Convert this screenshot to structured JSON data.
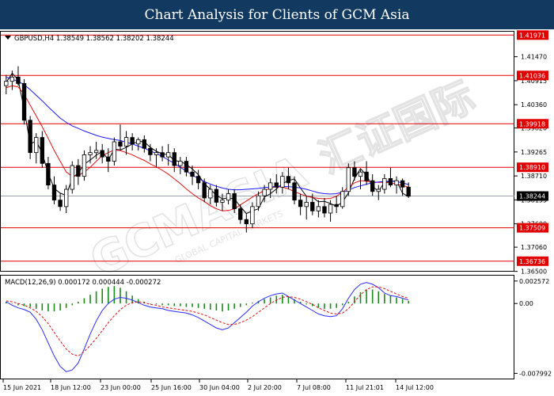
{
  "banner": {
    "title": "Chart Analysis for Clients of GCM Asia"
  },
  "colors": {
    "banner_bg": "#12395f",
    "level_line": "#e00000",
    "ma_fast": "#000000",
    "ma_mid": "#e01010",
    "ma_slow": "#1a1aff",
    "macd_line": "#2a2aff",
    "signal_line": "#e01010",
    "histogram": "#1a8a1a",
    "candle": "#000000"
  },
  "watermark": {
    "brand": "GCMASIA",
    "chinese": "汇证国际",
    "tagline": "GLOBAL CAPITAL MARKETS"
  },
  "main_chart": {
    "symbol_info": "GBPUSD,H4  1.38549 1.38562 1.38202 1.38244",
    "ylim": [
      1.3653,
      1.4205
    ],
    "y_ticks": [
      "1.41470",
      "1.40915",
      "1.40360",
      "1.39820",
      "1.39265",
      "1.38710",
      "1.38155",
      "1.37600",
      "1.37060",
      "1.36500"
    ],
    "levels": [
      {
        "value": 1.41971,
        "label": "1.41971"
      },
      {
        "value": 1.41036,
        "label": "1.41036"
      },
      {
        "value": 1.39918,
        "label": "1.39918"
      },
      {
        "value": 1.3891,
        "label": "1.38910"
      },
      {
        "value": 1.37509,
        "label": "1.37509"
      },
      {
        "value": 1.36736,
        "label": "1.36736"
      }
    ],
    "current_price": {
      "value": 1.38244,
      "label": "1.38244"
    }
  },
  "macd_panel": {
    "label": "MACD(12,26,9) 0.000172 0.000444 -0.000272",
    "ylim": [
      -0.0085,
      0.0031
    ],
    "y_ticks": [
      {
        "value": 0.002572,
        "label": "0.002572"
      },
      {
        "value": 0.0,
        "label": "0.00"
      },
      {
        "value": -0.007992,
        "label": "-0.007992"
      }
    ]
  },
  "x_axis": {
    "labels": [
      "15 Jun 2021",
      "18 Jun 12:00",
      "23 Jun 00:00",
      "25 Jun 16:00",
      "30 Jun 04:00",
      "2 Jul 20:00",
      "7 Jul 08:00",
      "11 Jul 21:01",
      "14 Jul 12:00"
    ]
  },
  "chart_data": {
    "type": "line",
    "series": [
      {
        "values": [
          1.4087,
          1.4109,
          1.4093,
          1.4025,
          1.3945,
          1.3952,
          1.3924,
          1.3877,
          1.3842,
          1.3831,
          1.3826,
          1.3866,
          1.3878,
          1.3898,
          1.3908,
          1.3919,
          1.3928,
          1.3908,
          1.3933,
          1.3931,
          1.3937,
          1.3945,
          1.3951,
          1.395,
          1.3937,
          1.3928,
          1.3922,
          1.392,
          1.3907,
          1.3904,
          1.3898,
          1.3887,
          1.3874,
          1.3853,
          1.384,
          1.3826,
          1.3818,
          1.382,
          1.3818,
          1.38,
          1.3784,
          1.379,
          1.3795,
          1.3822,
          1.383,
          1.3841,
          1.3853,
          1.386,
          1.3864,
          1.3843,
          1.3824,
          1.3822,
          1.3811,
          1.3812,
          1.3807,
          1.3801,
          1.381,
          1.3832,
          1.3865,
          1.3888,
          1.3872,
          1.3847,
          1.3835,
          1.3857,
          1.3858,
          1.386,
          1.3831,
          1.3823
        ]
      },
      {
        "values": [
          1.4075,
          1.408,
          1.4077,
          1.406,
          1.4035,
          1.401,
          1.3985,
          1.3958,
          1.393,
          1.3905,
          1.388,
          1.387,
          1.3872,
          1.388,
          1.3891,
          1.3905,
          1.3918,
          1.3925,
          1.3931,
          1.393,
          1.3925,
          1.392,
          1.3913,
          1.3907,
          1.3899,
          1.3892,
          1.3884,
          1.3875,
          1.3864,
          1.3853,
          1.3841,
          1.383,
          1.382,
          1.3812,
          1.3802,
          1.3795,
          1.379,
          1.3791,
          1.3795,
          1.3804,
          1.3813,
          1.3822,
          1.383,
          1.3837,
          1.3843,
          1.3846,
          1.3845,
          1.3841,
          1.3835,
          1.3829,
          1.3824,
          1.3821,
          1.3819,
          1.3818,
          1.3819,
          1.3824,
          1.3833,
          1.3845,
          1.3855,
          1.386,
          1.3859,
          1.3857,
          1.3856,
          1.3856,
          1.3855,
          1.3852,
          1.3849,
          1.3845
        ]
      },
      {
        "values": [
          1.41,
          1.4095,
          1.409,
          1.4082,
          1.4071,
          1.4058,
          1.4045,
          1.4031,
          1.4018,
          1.4005,
          1.3995,
          1.3987,
          1.3981,
          1.3975,
          1.397,
          1.3965,
          1.3961,
          1.3958,
          1.3955,
          1.3953,
          1.3949,
          1.3945,
          1.394,
          1.3935,
          1.3929,
          1.3923,
          1.3916,
          1.3908,
          1.39,
          1.3891,
          1.3882,
          1.3873,
          1.3865,
          1.3858,
          1.3852,
          1.3847,
          1.3843,
          1.384,
          1.3839,
          1.3839,
          1.384,
          1.3841,
          1.3842,
          1.3844,
          1.3845,
          1.3847,
          1.3847,
          1.3846,
          1.3845,
          1.3843,
          1.384,
          1.3836,
          1.3832,
          1.383,
          1.3829,
          1.383,
          1.3833,
          1.3838,
          1.3844,
          1.3848,
          1.3852,
          1.3855,
          1.3857,
          1.3858,
          1.3859,
          1.3858,
          1.3855,
          1.3851
        ]
      },
      {
        "values": [
          0.0002,
          -0.0002,
          -0.0005,
          -0.0007,
          -0.001,
          -0.0018,
          -0.003,
          -0.0045,
          -0.006,
          -0.0072,
          -0.0078,
          -0.0076,
          -0.0068,
          -0.0052,
          -0.0035,
          -0.002,
          -0.0008,
          0.0,
          0.0005,
          0.0007,
          0.0006,
          0.0004,
          0.0001,
          -0.0002,
          -0.0004,
          -0.0005,
          -0.0006,
          -0.0008,
          -0.0009,
          -0.001,
          -0.0011,
          -0.0013,
          -0.0016,
          -0.002,
          -0.0024,
          -0.0028,
          -0.003,
          -0.0028,
          -0.0022,
          -0.0016,
          -0.001,
          -0.0003,
          0.0002,
          0.0006,
          0.0009,
          0.0011,
          0.0012,
          0.0008,
          0.0004,
          0.0,
          -0.0004,
          -0.0008,
          -0.0012,
          -0.0014,
          -0.0015,
          -0.0014,
          -0.0006,
          0.0006,
          0.0016,
          0.0022,
          0.0024,
          0.0022,
          0.0018,
          0.0012,
          0.0009,
          0.0008,
          0.0006,
          0.0004
        ]
      },
      {
        "values": [
          0.0003,
          0.0002,
          0.0,
          -0.0002,
          -0.0005,
          -0.0009,
          -0.0015,
          -0.0023,
          -0.0033,
          -0.0043,
          -0.0052,
          -0.0058,
          -0.006,
          -0.0055,
          -0.0048,
          -0.004,
          -0.0031,
          -0.0022,
          -0.0014,
          -0.0007,
          -0.0002,
          0.0001,
          0.0002,
          0.0001,
          -0.0001,
          -0.0002,
          -0.0004,
          -0.0005,
          -0.0006,
          -0.0007,
          -0.0008,
          -0.0009,
          -0.0011,
          -0.0013,
          -0.0016,
          -0.0019,
          -0.0022,
          -0.0024,
          -0.0024,
          -0.0022,
          -0.0019,
          -0.0015,
          -0.001,
          -0.0005,
          0.0,
          0.0004,
          0.0007,
          0.0008,
          0.0007,
          0.0005,
          0.0002,
          -0.0001,
          -0.0005,
          -0.0008,
          -0.0011,
          -0.0012,
          -0.0011,
          -0.0006,
          0.0002,
          0.001,
          0.0016,
          0.0019,
          0.0019,
          0.0017,
          0.0014,
          0.0011,
          0.0008,
          0.0006
        ]
      },
      {
        "values": [
          -0.0001,
          -0.0004,
          -0.0005,
          -0.0005,
          -0.0005,
          -0.0009,
          -0.0015,
          -0.0022,
          -0.0027,
          -0.0029,
          -0.0026,
          -0.0018,
          -0.0008,
          0.0003,
          0.0013,
          0.002,
          0.0023,
          0.0022,
          0.0019,
          0.0014,
          0.0008,
          0.0003,
          -0.0001,
          -0.0003,
          -0.0003,
          -0.0003,
          -0.0002,
          -0.0003,
          -0.0003,
          -0.0003,
          -0.0003,
          -0.0004,
          -0.0005,
          -0.0007,
          -0.0008,
          -0.0009,
          -0.0008,
          -0.0004,
          0.0002,
          0.0006,
          0.0009,
          0.0012,
          0.0012,
          0.0011,
          0.0009,
          0.0007,
          0.0005,
          0.0,
          -0.0003,
          -0.0005,
          -0.0006,
          -0.0007,
          -0.0007,
          -0.0006,
          -0.0004,
          -0.0002,
          0.0005,
          0.0012,
          0.0014,
          0.0012,
          0.0008,
          0.0003,
          -0.0001,
          -0.0005,
          -0.0005,
          -0.0003,
          -0.0002,
          -0.0002
        ]
      }
    ],
    "candles": [
      [
        1.408,
        1.4105,
        1.406,
        1.409
      ],
      [
        1.409,
        1.4115,
        1.407,
        1.41
      ],
      [
        1.41,
        1.4125,
        1.408,
        1.4085
      ],
      [
        1.4085,
        1.4095,
        1.399,
        1.4
      ],
      [
        1.4,
        1.401,
        1.391,
        1.3925
      ],
      [
        1.3925,
        1.397,
        1.39,
        1.396
      ],
      [
        1.396,
        1.3975,
        1.389,
        1.39
      ],
      [
        1.39,
        1.3915,
        1.384,
        1.385
      ],
      [
        1.385,
        1.387,
        1.3805,
        1.3815
      ],
      [
        1.3815,
        1.383,
        1.379,
        1.38
      ],
      [
        1.38,
        1.385,
        1.3785,
        1.384
      ],
      [
        1.384,
        1.3905,
        1.383,
        1.3895
      ],
      [
        1.3895,
        1.391,
        1.385,
        1.387
      ],
      [
        1.387,
        1.393,
        1.386,
        1.392
      ],
      [
        1.392,
        1.394,
        1.39,
        1.3925
      ],
      [
        1.3925,
        1.395,
        1.391,
        1.393
      ],
      [
        1.393,
        1.3945,
        1.39,
        1.3915
      ],
      [
        1.3915,
        1.3935,
        1.388,
        1.3905
      ],
      [
        1.3905,
        1.396,
        1.3895,
        1.395
      ],
      [
        1.395,
        1.399,
        1.393,
        1.394
      ],
      [
        1.394,
        1.3975,
        1.392,
        1.396
      ],
      [
        1.396,
        1.397,
        1.393,
        1.3945
      ],
      [
        1.3945,
        1.396,
        1.393,
        1.3955
      ],
      [
        1.3955,
        1.3965,
        1.3925,
        1.3935
      ],
      [
        1.3935,
        1.3945,
        1.3905,
        1.392
      ],
      [
        1.392,
        1.3935,
        1.389,
        1.3925
      ],
      [
        1.3925,
        1.394,
        1.3905,
        1.3915
      ],
      [
        1.3915,
        1.3945,
        1.3895,
        1.3925
      ],
      [
        1.3925,
        1.3935,
        1.388,
        1.3895
      ],
      [
        1.3895,
        1.3915,
        1.3875,
        1.3905
      ],
      [
        1.3905,
        1.3915,
        1.387,
        1.388
      ],
      [
        1.388,
        1.3895,
        1.385,
        1.387
      ],
      [
        1.387,
        1.3885,
        1.384,
        1.3855
      ],
      [
        1.3855,
        1.3865,
        1.381,
        1.382
      ],
      [
        1.382,
        1.385,
        1.3805,
        1.384
      ],
      [
        1.384,
        1.385,
        1.38,
        1.381
      ],
      [
        1.381,
        1.383,
        1.379,
        1.3815
      ],
      [
        1.3815,
        1.384,
        1.3805,
        1.383
      ],
      [
        1.383,
        1.384,
        1.3785,
        1.3795
      ],
      [
        1.3795,
        1.3805,
        1.376,
        1.377
      ],
      [
        1.377,
        1.3785,
        1.374,
        1.376
      ],
      [
        1.376,
        1.381,
        1.375,
        1.38
      ],
      [
        1.38,
        1.3835,
        1.379,
        1.3825
      ],
      [
        1.3825,
        1.385,
        1.381,
        1.384
      ],
      [
        1.384,
        1.3865,
        1.382,
        1.3855
      ],
      [
        1.3855,
        1.3875,
        1.383,
        1.3845
      ],
      [
        1.3845,
        1.388,
        1.383,
        1.387
      ],
      [
        1.387,
        1.389,
        1.384,
        1.3855
      ],
      [
        1.3855,
        1.387,
        1.3805,
        1.3815
      ],
      [
        1.3815,
        1.383,
        1.378,
        1.38
      ],
      [
        1.38,
        1.3825,
        1.377,
        1.381
      ],
      [
        1.381,
        1.383,
        1.378,
        1.379
      ],
      [
        1.379,
        1.3815,
        1.3775,
        1.38
      ],
      [
        1.38,
        1.382,
        1.3775,
        1.3785
      ],
      [
        1.3785,
        1.3815,
        1.3765,
        1.3805
      ],
      [
        1.3805,
        1.3825,
        1.3785,
        1.38
      ],
      [
        1.38,
        1.3845,
        1.3795,
        1.3835
      ],
      [
        1.3835,
        1.39,
        1.3825,
        1.389
      ],
      [
        1.389,
        1.3905,
        1.386,
        1.387
      ],
      [
        1.387,
        1.3885,
        1.384,
        1.388
      ],
      [
        1.388,
        1.3905,
        1.385,
        1.386
      ],
      [
        1.386,
        1.3875,
        1.3825,
        1.3835
      ],
      [
        1.3835,
        1.385,
        1.3815,
        1.384
      ],
      [
        1.384,
        1.3875,
        1.383,
        1.3865
      ],
      [
        1.3865,
        1.389,
        1.3845,
        1.385
      ],
      [
        1.385,
        1.387,
        1.383,
        1.386
      ],
      [
        1.386,
        1.3865,
        1.3825,
        1.3845
      ],
      [
        1.3845,
        1.3856,
        1.382,
        1.3824
      ]
    ],
    "histogram": [
      0.0002,
      0.0,
      -0.0002,
      -0.0003,
      -0.0004,
      -0.0006,
      -0.0008,
      -0.0009,
      -0.0009,
      -0.0008,
      -0.0005,
      -0.0002,
      0.0002,
      0.0006,
      0.001,
      0.0014,
      0.0017,
      0.0019,
      0.002,
      0.0018,
      0.0014,
      0.0009,
      0.0005,
      0.0002,
      0.0,
      -0.0001,
      -0.0002,
      -0.0002,
      -0.0003,
      -0.0003,
      -0.0004,
      -0.0004,
      -0.0005,
      -0.0006,
      -0.0007,
      -0.0008,
      -0.0009,
      -0.0008,
      -0.0006,
      -0.0004,
      -0.0002,
      0.0001,
      0.0003,
      0.0005,
      0.0007,
      0.0009,
      0.001,
      0.0008,
      0.0005,
      0.0002,
      -0.0001,
      -0.0003,
      -0.0005,
      -0.0006,
      -0.0006,
      -0.0005,
      -0.0002,
      0.0002,
      0.0008,
      0.0013,
      0.0016,
      0.0016,
      0.0014,
      0.0011,
      0.0009,
      0.0007,
      0.0005,
      0.0003
    ]
  }
}
